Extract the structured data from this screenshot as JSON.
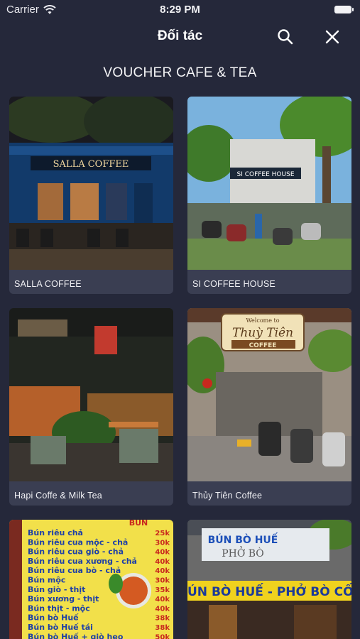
{
  "status_bar": {
    "carrier": "Carrier",
    "time": "8:29 PM"
  },
  "nav": {
    "title": "Đối tác"
  },
  "section": {
    "title": "VOUCHER CAFE & TEA"
  },
  "cards": [
    {
      "name": "SALLA COFFEE",
      "sign_text": "SALLA COFFEE"
    },
    {
      "name": "SI COFFEE HOUSE",
      "sign_text": "SI COFFEE HOUSE"
    },
    {
      "name": "Hapi Coffe & Milk Tea"
    },
    {
      "name": "Thủy Tiên Coffee",
      "sign_line1": "Welcome to",
      "sign_line2": "Thuỳ Tiên",
      "sign_line3": "COFFEE"
    },
    {
      "menu_header": "BÚN",
      "menu_items": [
        {
          "item": "Bún riêu chả",
          "price": "25k"
        },
        {
          "item": "Bún riêu cua mộc - chả",
          "price": "30k"
        },
        {
          "item": "Bún riêu cua giò - chả",
          "price": "40k"
        },
        {
          "item": "Bún riêu cua xương - chả",
          "price": "40k"
        },
        {
          "item": "Bún riêu cua bò - chả",
          "price": "40k"
        },
        {
          "item": "Bún mộc",
          "price": "30k"
        },
        {
          "item": "Bún giò - thịt",
          "price": "35k"
        },
        {
          "item": "Bún xương - thịt",
          "price": "40k"
        },
        {
          "item": "Bún thịt - mộc",
          "price": "40k"
        },
        {
          "item": "Bún bò Huế",
          "price": "38k"
        },
        {
          "item": "Bún bò Huế tái",
          "price": "38k"
        },
        {
          "item": "Bún bò Huế + giò heo",
          "price": "50k"
        }
      ]
    },
    {
      "sign_line1": "BÚN BÒ HUẾ",
      "sign_line2": "PHỞ BÒ",
      "banner": "ÚN BÒ HUẾ - PHỞ BÒ CỐ"
    }
  ]
}
